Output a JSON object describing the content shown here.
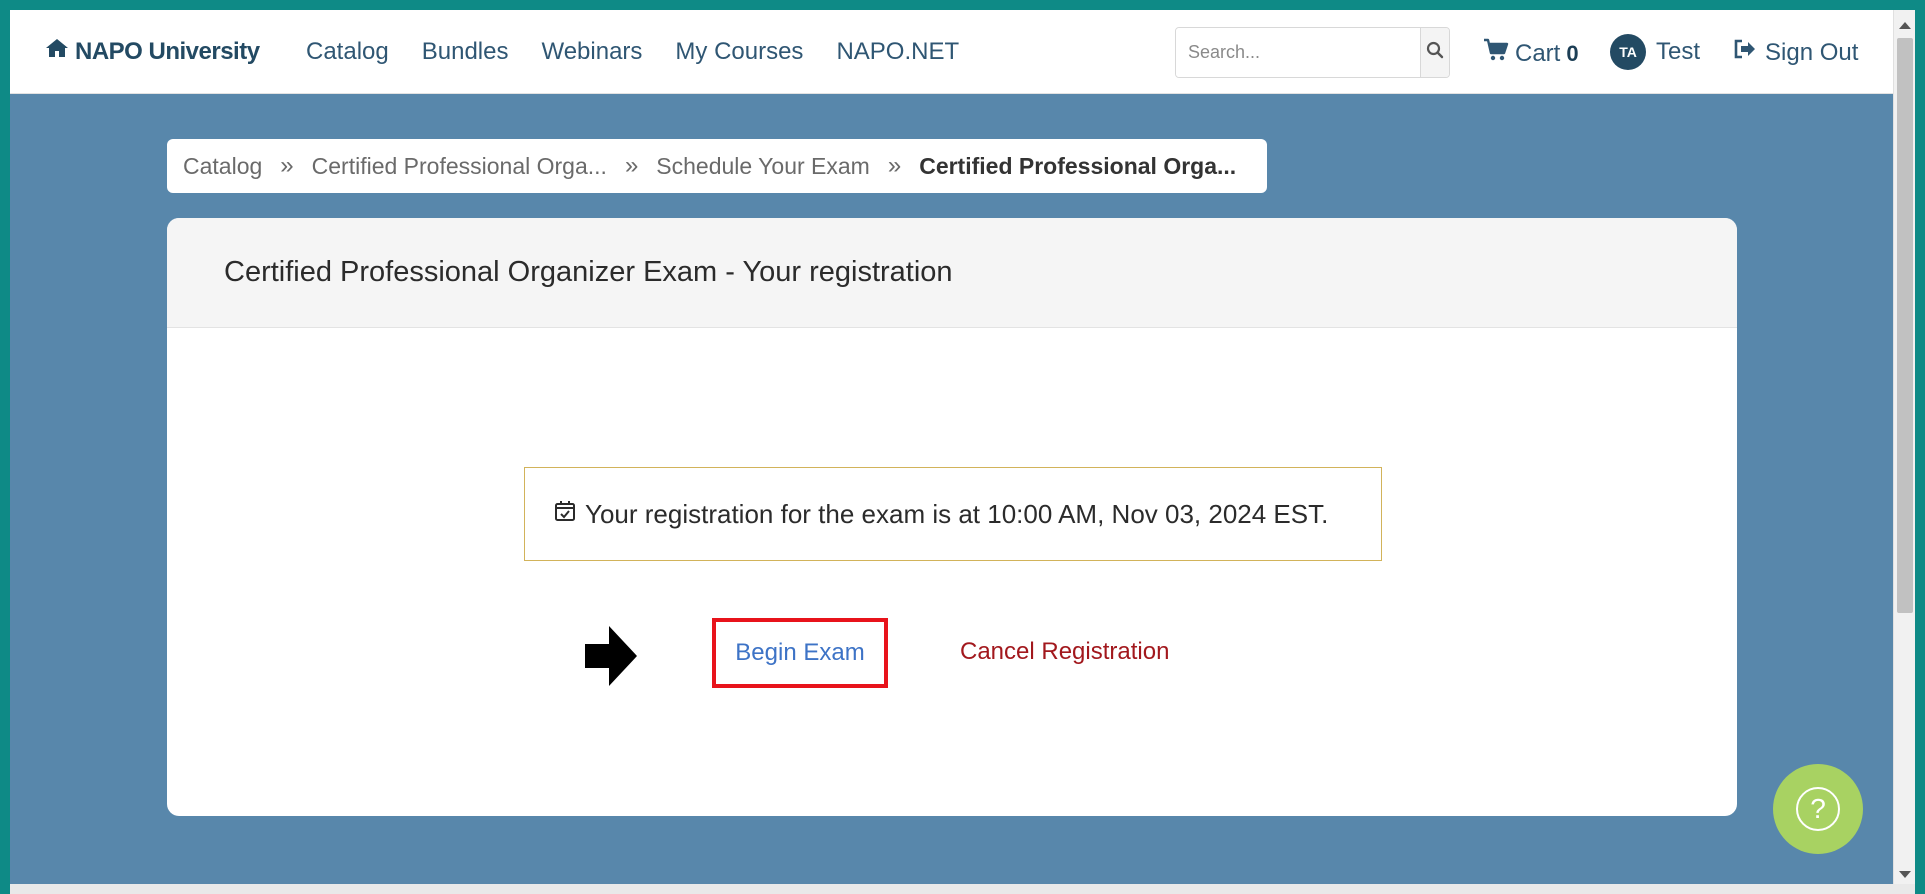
{
  "navbar": {
    "brand": "NAPO University",
    "links": [
      "Catalog",
      "Bundles",
      "Webinars",
      "My Courses",
      "NAPO.NET"
    ],
    "search_placeholder": "Search...",
    "cart_label": "Cart",
    "cart_count": "0",
    "user_initials": "TA",
    "user_name": "Test",
    "signout_label": "Sign Out"
  },
  "breadcrumb": {
    "items": [
      "Catalog",
      "Certified Professional Orga...",
      "Schedule Your Exam",
      "Certified Professional Orga..."
    ]
  },
  "card": {
    "title": "Certified Professional Organizer Exam - Your registration",
    "notice": "Your registration for the exam is at 10:00 AM, Nov 03, 2024 EST.",
    "begin_label": "Begin Exam",
    "cancel_label": "Cancel Registration"
  },
  "colors": {
    "background": "#5887ab",
    "brand": "#234a63",
    "highlight_border": "#e8131b",
    "begin_text": "#3d73c6",
    "cancel_text": "#a2181d",
    "help_button": "#a8d262"
  }
}
